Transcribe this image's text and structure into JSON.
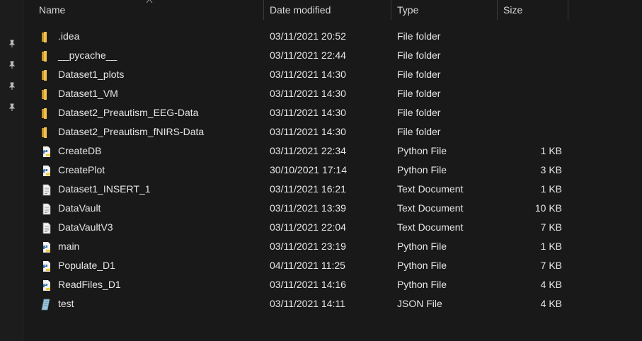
{
  "columns": {
    "name": "Name",
    "date": "Date modified",
    "type": "Type",
    "size": "Size"
  },
  "files": [
    {
      "name": ".idea",
      "date": "03/11/2021 20:52",
      "type": "File folder",
      "size": "",
      "icon": "folder-icon"
    },
    {
      "name": "__pycache__",
      "date": "03/11/2021 22:44",
      "type": "File folder",
      "size": "",
      "icon": "folder-icon"
    },
    {
      "name": "Dataset1_plots",
      "date": "03/11/2021 14:30",
      "type": "File folder",
      "size": "",
      "icon": "folder-icon"
    },
    {
      "name": "Dataset1_VM",
      "date": "03/11/2021 14:30",
      "type": "File folder",
      "size": "",
      "icon": "folder-icon"
    },
    {
      "name": "Dataset2_Preautism_EEG-Data",
      "date": "03/11/2021 14:30",
      "type": "File folder",
      "size": "",
      "icon": "folder-icon"
    },
    {
      "name": "Dataset2_Preautism_fNIRS-Data",
      "date": "03/11/2021 14:30",
      "type": "File folder",
      "size": "",
      "icon": "folder-icon"
    },
    {
      "name": "CreateDB",
      "date": "03/11/2021 22:34",
      "type": "Python File",
      "size": "1 KB",
      "icon": "python-file-icon"
    },
    {
      "name": "CreatePlot",
      "date": "30/10/2021 17:14",
      "type": "Python File",
      "size": "3 KB",
      "icon": "python-file-icon"
    },
    {
      "name": "Dataset1_INSERT_1",
      "date": "03/11/2021 16:21",
      "type": "Text Document",
      "size": "1 KB",
      "icon": "text-file-icon"
    },
    {
      "name": "DataVault",
      "date": "03/11/2021 13:39",
      "type": "Text Document",
      "size": "10 KB",
      "icon": "text-file-icon"
    },
    {
      "name": "DataVaultV3",
      "date": "03/11/2021 22:04",
      "type": "Text Document",
      "size": "7 KB",
      "icon": "text-file-icon"
    },
    {
      "name": "main",
      "date": "03/11/2021 23:19",
      "type": "Python File",
      "size": "1 KB",
      "icon": "python-file-icon"
    },
    {
      "name": "Populate_D1",
      "date": "04/11/2021 11:25",
      "type": "Python File",
      "size": "7 KB",
      "icon": "python-file-icon"
    },
    {
      "name": "ReadFiles_D1",
      "date": "03/11/2021 14:16",
      "type": "Python File",
      "size": "4 KB",
      "icon": "python-file-icon"
    },
    {
      "name": "test",
      "date": "03/11/2021 14:11",
      "type": "JSON File",
      "size": "4 KB",
      "icon": "json-file-icon"
    }
  ],
  "colors": {
    "background": "#191919",
    "text": "#e6e6e6",
    "folder": "#e8b640",
    "python_blue": "#3b73a8",
    "python_yellow": "#f2cc3d"
  }
}
